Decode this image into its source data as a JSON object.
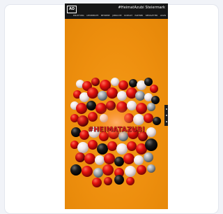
{
  "site": {
    "logo_text": "AO",
    "brand_text": "#HeimatAzubi Steiermark",
    "nav_items": [
      "EINLEITUNG",
      "LEHRBERUFE",
      "BETRIEBE",
      "JOBSUCHE",
      "KONTAKT",
      "PARTNER",
      "NEWSLETTER",
      "LOGIN"
    ]
  },
  "hero": {
    "headline": "#HEIMATAZUBI",
    "background_color": "#ef9310",
    "ball_colors": [
      "#e3100d",
      "#f5f0f0",
      "#141414",
      "#9aa0a6",
      "#c10f0f"
    ]
  },
  "side_tab": {
    "icons": [
      "share-icon",
      "menu-icon",
      "search-icon"
    ]
  }
}
